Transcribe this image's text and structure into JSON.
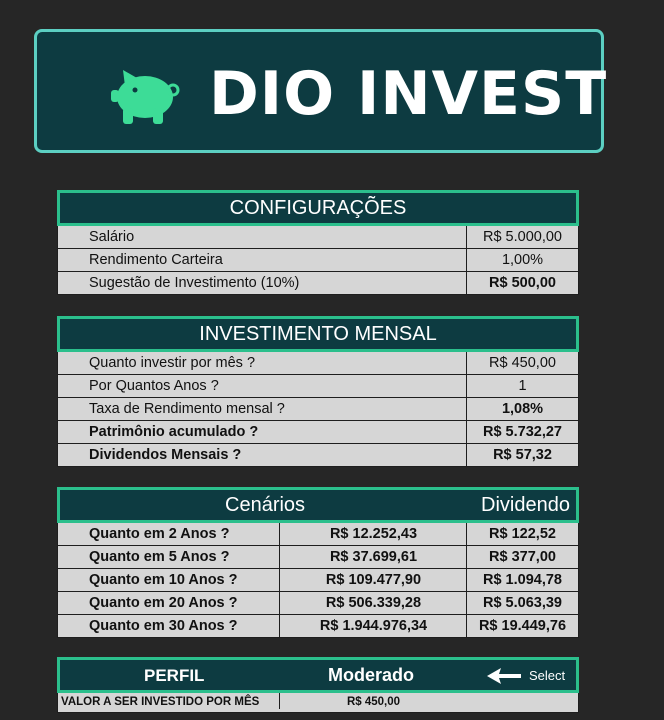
{
  "brand": {
    "title": "DIO INVEST",
    "logo_icon": "piggy-bank-icon"
  },
  "colors": {
    "banner_bg": "#0d3b41",
    "accent": "#2bbf8c",
    "piggy": "#3ddc97"
  },
  "config": {
    "title": "CONFIGURAÇÕES",
    "rows": [
      {
        "label": "Salário",
        "value": "R$ 5.000,00"
      },
      {
        "label": "Rendimento Carteira",
        "value": "1,00%"
      },
      {
        "label": "Sugestão de Investimento (10%)",
        "value": "R$ 500,00"
      }
    ]
  },
  "mensal": {
    "title": "INVESTIMENTO MENSAL",
    "rows": [
      {
        "label": "Quanto investir por mês ?",
        "value": "R$ 450,00"
      },
      {
        "label": "Por Quantos Anos ?",
        "value": "1"
      },
      {
        "label": "Taxa de Rendimento mensal ?",
        "value": "1,08%"
      },
      {
        "label": "Patrimônio acumulado ?",
        "value": "R$ 5.732,27"
      },
      {
        "label": "Dividendos Mensais ?",
        "value": "R$ 57,32"
      }
    ]
  },
  "cenarios": {
    "title": "Cenários",
    "dividend_header": "Dividendo",
    "rows": [
      {
        "label": "Quanto em 2 Anos ?",
        "total": "R$ 12.252,43",
        "dividend": "R$ 122,52"
      },
      {
        "label": "Quanto em 5 Anos ?",
        "total": "R$ 37.699,61",
        "dividend": "R$ 377,00"
      },
      {
        "label": "Quanto em 10 Anos ?",
        "total": "R$ 109.477,90",
        "dividend": "R$ 1.094,78"
      },
      {
        "label": "Quanto em 20 Anos ?",
        "total": "R$ 506.339,28",
        "dividend": "R$ 5.063,39"
      },
      {
        "label": "Quanto em 30 Anos ?",
        "total": "R$ 1.944.976,34",
        "dividend": "R$ 19.449,76"
      }
    ]
  },
  "perfil": {
    "label": "PERFIL",
    "value": "Moderado",
    "select_label": "Select",
    "arrow_icon": "arrow-left-icon",
    "invest_label": "VALOR A SER INVESTIDO POR MÊS",
    "invest_value": "R$ 450,00"
  }
}
